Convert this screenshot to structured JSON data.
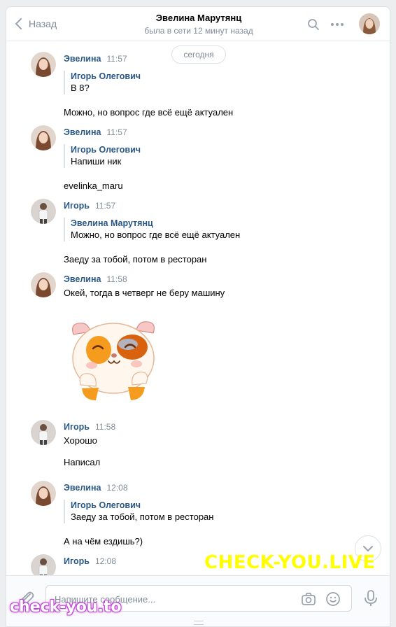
{
  "header": {
    "back_label": "Назад",
    "title": "Эвелина Марутянц",
    "subtitle": "была в сети 12 минут назад"
  },
  "date_separator": "сегодня",
  "messages": [
    {
      "author": "Эвелина",
      "time": "11:57",
      "quote_author": "Игорь Олегович",
      "quote_text": "В 8?",
      "text": "Можно, но вопрос где всё ещё актуален"
    },
    {
      "author": "Эвелина",
      "time": "11:57",
      "quote_author": "Игорь Олегович",
      "quote_text": "Напиши ник",
      "text": "evelinka_maru"
    },
    {
      "author": "Игорь",
      "time": "11:57",
      "quote_author": "Эвелина Марутянц",
      "quote_text": "Можно, но вопрос где всё ещё актуален",
      "text": "Заеду за тобой, потом в ресторан"
    },
    {
      "author": "Эвелина",
      "time": "11:58",
      "text": "Окей, тогда в четверг не беру машину",
      "sticker": "hamster-sticker"
    },
    {
      "author": "Игорь",
      "time": "11:58",
      "text": "Хорошо",
      "text2": "Написал"
    },
    {
      "author": "Эвелина",
      "time": "12:08",
      "quote_author": "Игорь Олегович",
      "quote_text": "Заеду за тобой, потом в ресторан",
      "text": "А на чём ездишь?)"
    },
    {
      "author": "Игорь",
      "time": "12:08"
    }
  ],
  "composer": {
    "placeholder": "Напишите сообщение..."
  },
  "watermarks": {
    "top": "CHECK-YOU.LIVE",
    "bottom": "check-you.to"
  },
  "colors": {
    "link": "#2a5885",
    "muted": "#818c99",
    "watermark_yellow": "#ffff00",
    "watermark_purple": "#c04bd6"
  }
}
